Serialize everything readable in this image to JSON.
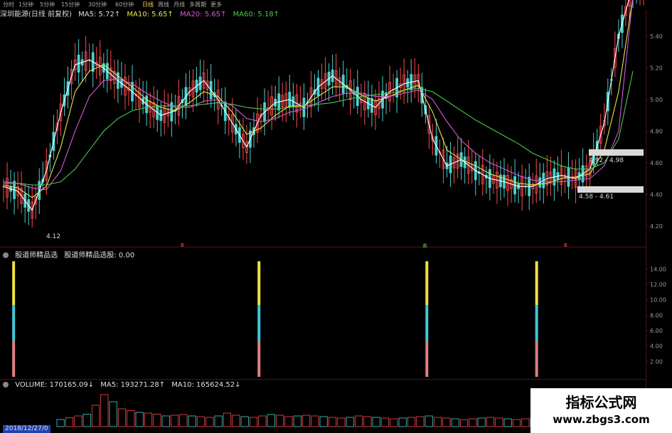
{
  "period_bar": {
    "items": [
      {
        "label": "分时",
        "active": false
      },
      {
        "label": "1分钟",
        "active": false
      },
      {
        "label": "5分钟",
        "active": false
      },
      {
        "label": "15分钟",
        "active": false
      },
      {
        "label": "30分钟",
        "active": false
      },
      {
        "label": "60分钟",
        "active": false
      },
      {
        "label": "日线",
        "active": true
      },
      {
        "label": "周线",
        "active": false
      },
      {
        "label": "月线",
        "active": false
      },
      {
        "label": "多周期",
        "active": false
      },
      {
        "label": "更多",
        "active": false
      }
    ]
  },
  "main_header": {
    "stock": "深圳能源(日线 前复权)",
    "ma5": "MA5: 5.72↑",
    "ma10": "MA10: 5.65↑",
    "ma20": "MA20: 5.65↑",
    "ma60": "MA60: 5.18↑"
  },
  "indicator_header": {
    "name": "股道师精品选",
    "value": "股道师精品选股: 0.00"
  },
  "volume_header": {
    "volume": "VOLUME: 170165.09↓",
    "ma5": "MA5: 193271.28↑",
    "ma10": "MA10: 165624.52↓"
  },
  "price_labels": {
    "range1": "4.92 - 4.98",
    "range2": "4.58 - 4.61",
    "low": "4.12"
  },
  "markers": {
    "b1": "B",
    "sell": "卖",
    "b2": "B"
  },
  "date_label": "2018/12/27/0",
  "watermark": {
    "line1": "指标公式网",
    "line2": "www.zbgs3.com"
  },
  "colors": {
    "up": "#ff4a4a",
    "down": "#4ad1d1",
    "ma5": "#ffffff",
    "ma10": "#e8e84a",
    "ma20": "#d65ad6",
    "ma60": "#4ac84a",
    "bar_yellow": "#f0e040",
    "bar_cyan": "#40c8d8",
    "bar_red": "#e08080"
  },
  "chart_data": [
    {
      "type": "line",
      "title": "深圳能源(日线 前复权)",
      "y_ticks": [
        4.2,
        4.4,
        4.6,
        4.8,
        5.0,
        5.2,
        5.4
      ],
      "ylim": [
        4.1,
        5.45
      ],
      "series": [
        {
          "name": "MA5",
          "values": [
            4.45,
            4.42,
            4.3,
            4.55,
            4.92,
            5.22,
            5.25,
            5.2,
            5.12,
            5.05,
            4.97,
            4.9,
            4.93,
            5.05,
            5.12,
            5.0,
            4.85,
            4.7,
            4.9,
            4.98,
            5.0,
            4.95,
            5.08,
            5.15,
            5.08,
            5.0,
            4.95,
            5.05,
            5.1,
            5.12,
            4.75,
            4.58,
            4.62,
            4.55,
            4.5,
            4.48,
            4.45,
            4.45,
            4.5,
            4.52,
            4.5,
            4.56,
            4.85,
            5.4,
            5.72
          ]
        },
        {
          "name": "MA10",
          "values": [
            4.46,
            4.44,
            4.38,
            4.45,
            4.7,
            5.05,
            5.18,
            5.22,
            5.15,
            5.08,
            5.0,
            4.95,
            4.93,
            4.98,
            5.05,
            5.02,
            4.92,
            4.78,
            4.82,
            4.9,
            4.96,
            4.96,
            5.02,
            5.08,
            5.08,
            5.03,
            4.99,
            5.02,
            5.06,
            5.09,
            4.92,
            4.68,
            4.62,
            4.58,
            4.53,
            4.5,
            4.47,
            4.46,
            4.47,
            4.5,
            4.51,
            4.53,
            4.68,
            5.05,
            5.65
          ]
        },
        {
          "name": "MA20",
          "values": [
            4.48,
            4.47,
            4.44,
            4.43,
            4.55,
            4.8,
            5.02,
            5.12,
            5.13,
            5.1,
            5.04,
            4.99,
            4.95,
            4.95,
            4.99,
            5.0,
            4.96,
            4.88,
            4.86,
            4.88,
            4.92,
            4.94,
            4.98,
            5.02,
            5.04,
            5.04,
            5.02,
            5.02,
            5.04,
            5.06,
            5.0,
            4.86,
            4.74,
            4.66,
            4.6,
            4.56,
            4.52,
            4.49,
            4.48,
            4.48,
            4.49,
            4.5,
            4.58,
            4.8,
            5.65
          ]
        },
        {
          "name": "MA60",
          "values": [
            4.47,
            4.47,
            4.46,
            4.46,
            4.48,
            4.56,
            4.68,
            4.8,
            4.88,
            4.93,
            4.95,
            4.96,
            4.96,
            4.96,
            4.97,
            4.98,
            4.97,
            4.95,
            4.94,
            4.94,
            4.95,
            4.96,
            4.97,
            4.98,
            5.0,
            5.02,
            5.03,
            5.04,
            5.06,
            5.07,
            5.05,
            4.99,
            4.93,
            4.87,
            4.82,
            4.77,
            4.72,
            4.66,
            4.62,
            4.58,
            4.56,
            4.56,
            4.6,
            4.75,
            5.18
          ]
        }
      ]
    },
    {
      "type": "bar",
      "title": "股道师精品选股",
      "y_ticks": [
        2.0,
        4.0,
        6.0,
        8.0,
        10.0,
        12.0,
        14.0
      ],
      "ylim": [
        0,
        15.5
      ],
      "signals": [
        {
          "position": 0.02,
          "value": 15.0
        },
        {
          "position": 0.4,
          "value": 15.0
        },
        {
          "position": 0.66,
          "value": 15.0
        },
        {
          "position": 0.83,
          "value": 15.0
        }
      ]
    },
    {
      "type": "bar",
      "title": "VOLUME",
      "values": [
        20,
        25,
        30,
        35,
        60,
        90,
        70,
        50,
        45,
        40,
        38,
        35,
        30,
        32,
        34,
        30,
        28,
        26,
        30,
        38,
        32,
        28,
        26,
        30,
        34,
        32,
        28,
        30,
        32,
        30,
        28,
        26,
        24,
        26,
        30,
        28,
        26,
        24,
        22,
        24,
        26,
        28,
        30,
        26,
        24,
        22,
        20,
        22,
        24,
        26,
        24,
        22,
        20,
        22,
        24,
        22,
        20,
        22,
        24,
        26
      ]
    }
  ]
}
